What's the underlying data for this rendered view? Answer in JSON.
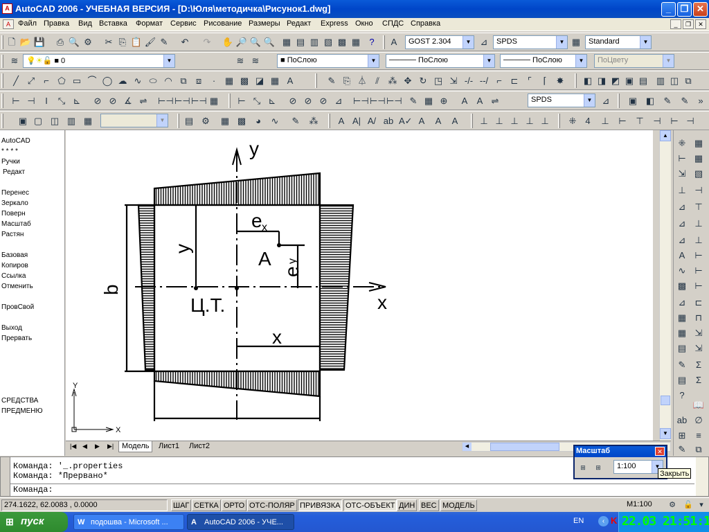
{
  "window": {
    "title": "AutoCAD 2006 - УЧЕБНАЯ ВЕРСИЯ - [D:\\Юля\\методичка\\Рисунок1.dwg]",
    "minimize": "_",
    "restore": "❐",
    "close": "✕"
  },
  "menu": {
    "items": [
      "Файл",
      "Правка",
      "Вид",
      "Вставка",
      "Формат",
      "Сервис",
      "Рисование",
      "Размеры",
      "Редакт",
      "Express",
      "Окно",
      "СПДС",
      "Справка"
    ]
  },
  "toolbar1": {
    "text_style": "GOST 2.304",
    "dim_style": "SPDS",
    "table_style": "Standard"
  },
  "layers": {
    "current_layer": "0",
    "color": "ПоСлою",
    "linetype": "ПоСлою",
    "lineweight": "ПоСлою",
    "plotstyle": "ПоЦвету"
  },
  "toolbar3": {
    "dim_style2": "SPDS"
  },
  "sidemenu": {
    "items": [
      "AutoCAD",
      "* * * *",
      "Ручки",
      "Редакт",
      "",
      "Перенес",
      "Зеркало",
      "Поверн",
      "Масштаб",
      "Растян",
      "",
      "Базовая",
      "Копиров",
      "Ссылка",
      "Отменить",
      "",
      "ПровСвой",
      "",
      "Выход",
      "Прервать",
      "",
      "",
      "",
      "",
      "",
      "СРЕДСТВА",
      "ПРЕДМЕНЮ"
    ]
  },
  "drawing": {
    "labels": {
      "y_axis": "y",
      "x_axis": "x",
      "b": "b",
      "y_dim": "y",
      "x_dim": "x",
      "ex": "e",
      "ex_sub": "x",
      "ey": "e",
      "ey_sub": "y",
      "A": "A",
      "center": "Ц.Т."
    },
    "ucs": {
      "x": "X",
      "y": "Y"
    }
  },
  "tabs": {
    "items": [
      "Модель",
      "Лист1",
      "Лист2"
    ]
  },
  "command": {
    "lines": [
      "Команда: '_.properties",
      "Команда: *Прервано*"
    ],
    "prompt": "Команда:"
  },
  "masshtab_panel": {
    "title": "Масштаб",
    "value": "1:100",
    "tooltip": "Закрыть"
  },
  "status": {
    "coords": "274.1622, 62.0083 , 0.0000",
    "buttons": [
      "ШАГ",
      "СЕТКА",
      "ОРТО",
      "ОТС-ПОЛЯР",
      "ПРИВЯЗКА",
      "ОТС-ОБЪЕКТ",
      "ДИН",
      "ВЕС",
      "МОДЕЛЬ"
    ],
    "scale": "М1:100"
  },
  "taskbar": {
    "start": "пуск",
    "tasks": [
      "подошва - Microsoft ...",
      "AutoCAD 2006 - УЧЕ..."
    ],
    "lang": "EN",
    "clock": "22.03 21:51:12"
  }
}
